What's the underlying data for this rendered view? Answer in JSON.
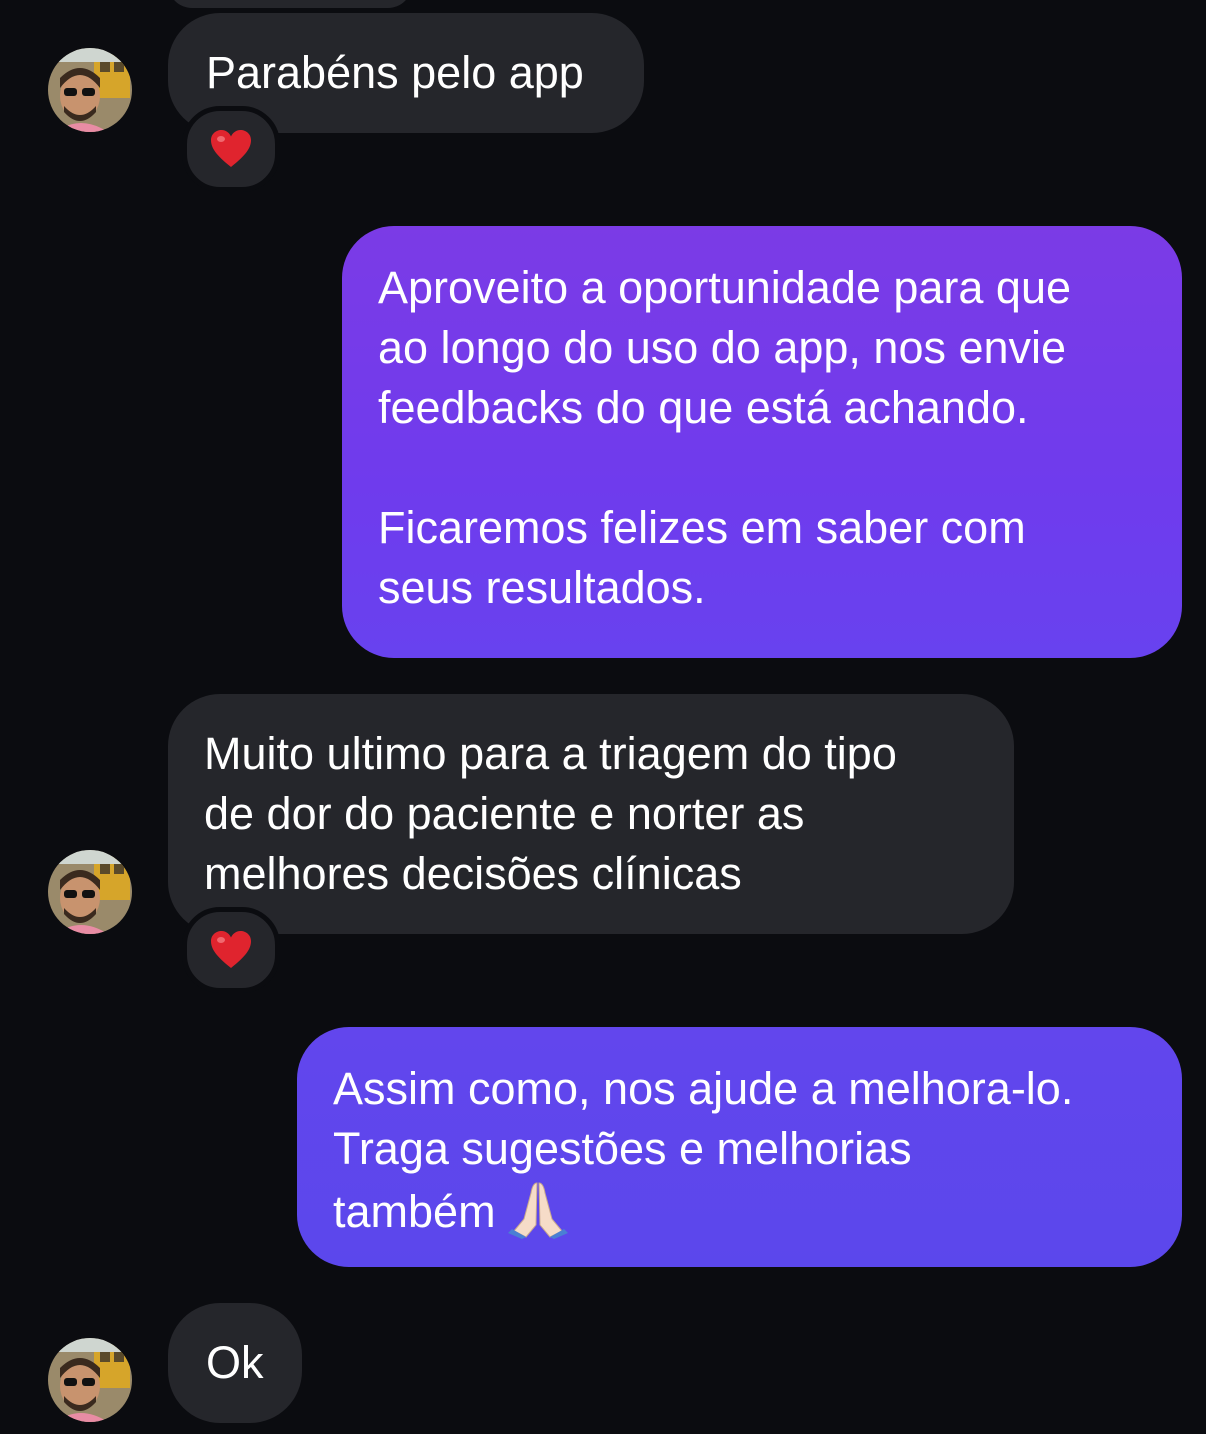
{
  "conversation": {
    "messages": [
      {
        "sender": "incoming",
        "lines": [
          "Parabéns pelo app"
        ],
        "reaction": "red-heart"
      },
      {
        "sender": "outgoing",
        "paragraphs": [
          [
            "Aproveito a oportunidade para que",
            "ao longo do uso do app, nos envie",
            "feedbacks do que está achando."
          ],
          [
            "Ficaremos felizes em saber com",
            "seus resultados."
          ]
        ]
      },
      {
        "sender": "incoming",
        "lines": [
          "Muito ultimo para a triagem do tipo",
          "de dor do paciente e norter as",
          "melhores decisões clínicas"
        ],
        "reaction": "red-heart"
      },
      {
        "sender": "outgoing",
        "lines": [
          "Assim como, nos ajude a melhora-lo.",
          "Traga sugestões e melhorias",
          "também"
        ],
        "emoji": "folded-hands"
      },
      {
        "sender": "incoming",
        "lines": [
          "Ok"
        ]
      }
    ]
  },
  "colors": {
    "background": "#0b0c10",
    "incoming_bubble": "#25262b",
    "outgoing_bubble_top": "#7b3be6",
    "outgoing_bubble_bottom": "#5b47ec",
    "text": "#ffffff",
    "reaction_heart": "#e0242e"
  }
}
